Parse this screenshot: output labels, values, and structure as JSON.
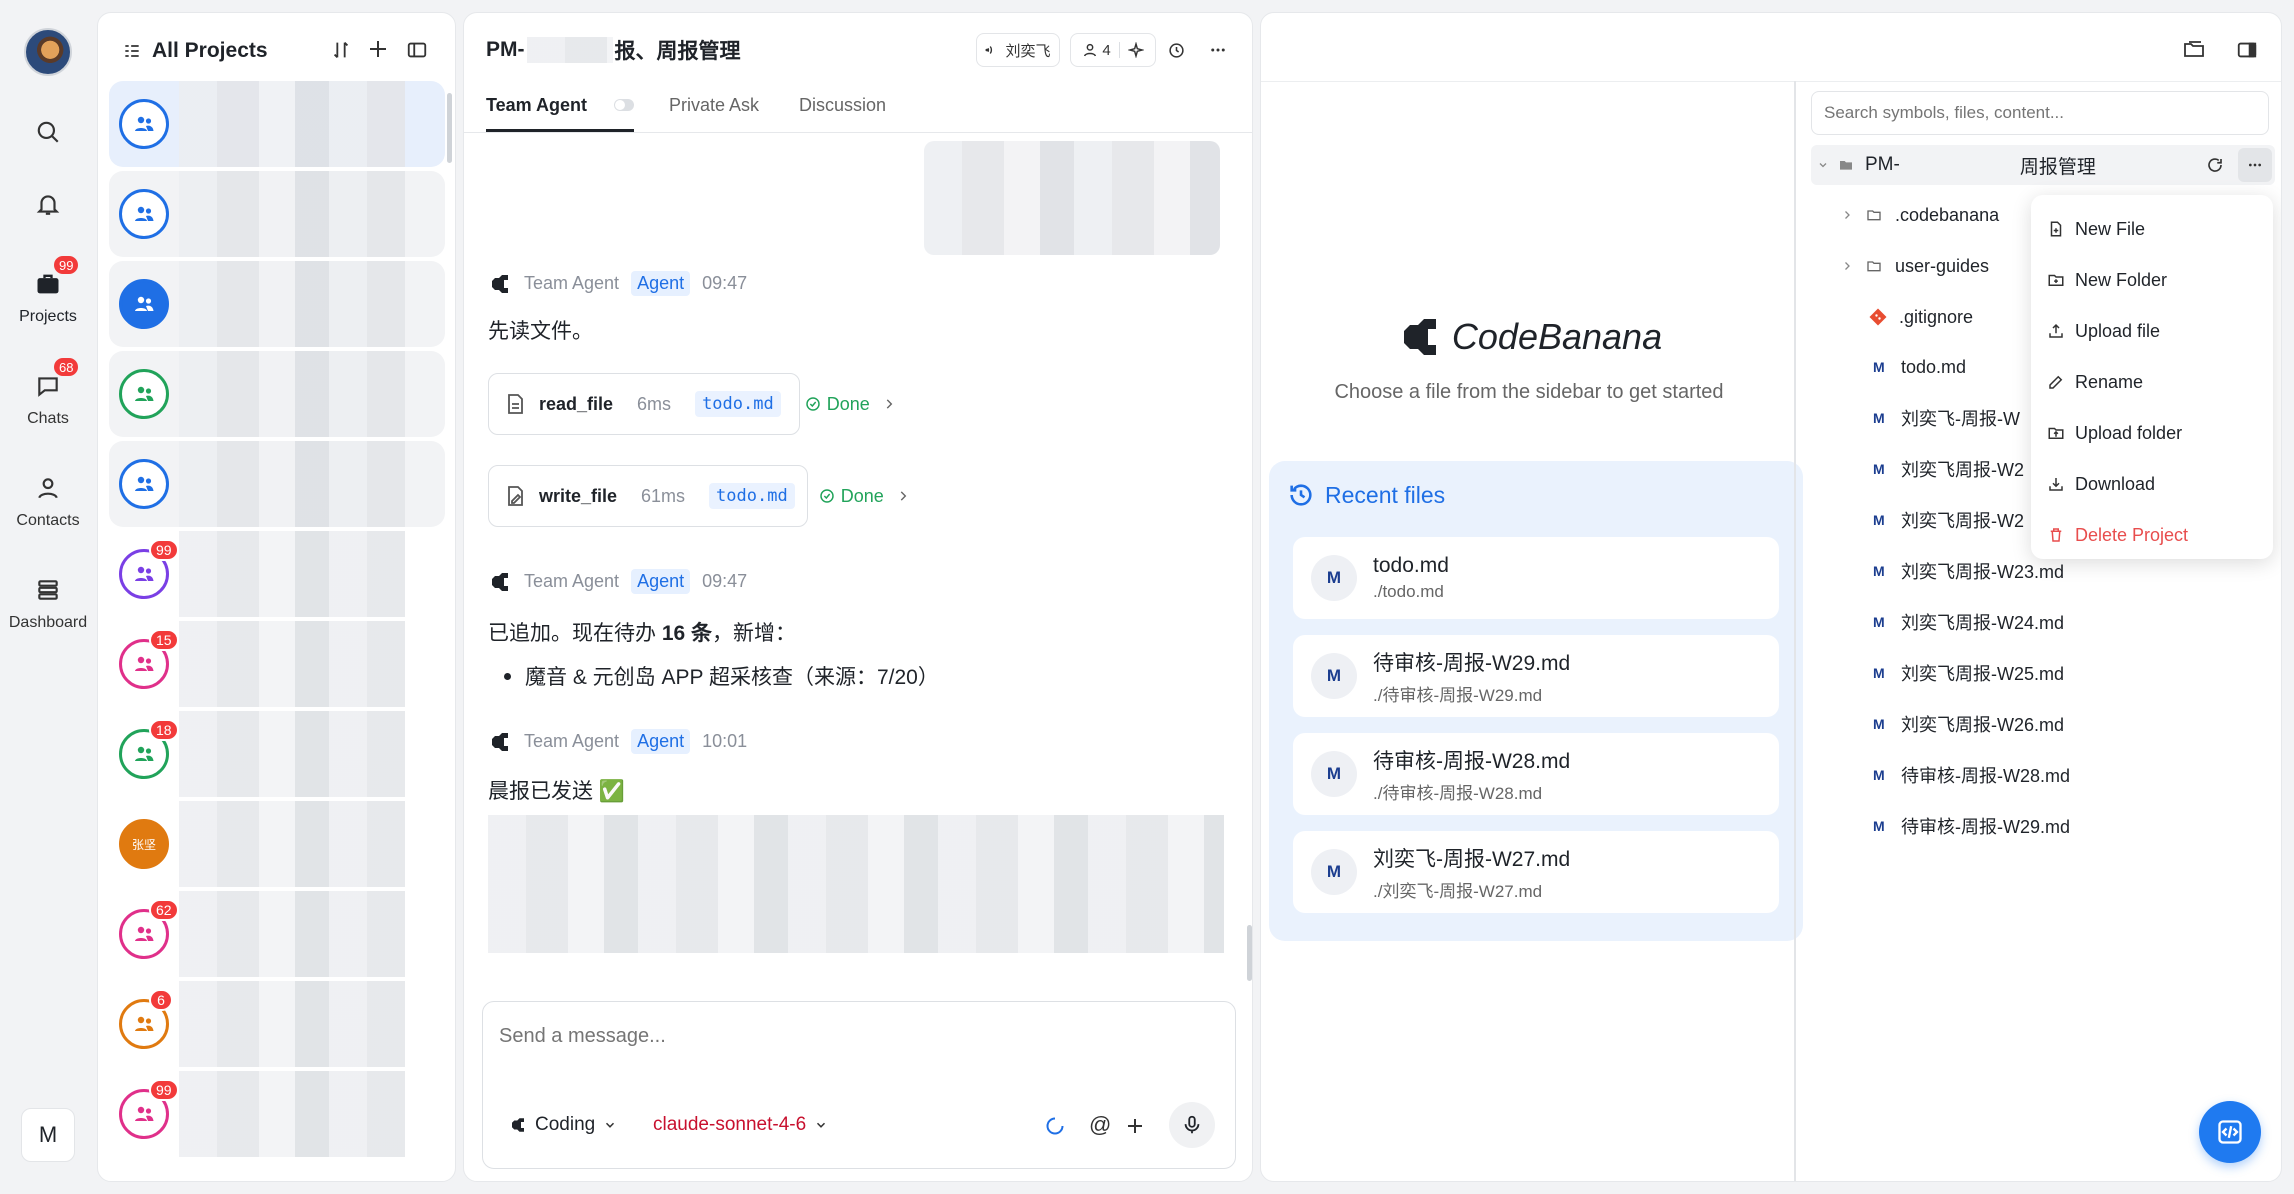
{
  "rail": {
    "avatar_initial": "",
    "items": [
      {
        "label": "",
        "icon": "search-icon"
      },
      {
        "label": "",
        "icon": "bell-icon"
      },
      {
        "label": "Projects",
        "badge": "99",
        "icon": "briefcase-icon"
      },
      {
        "label": "Chats",
        "badge": "68",
        "icon": "chat-icon"
      },
      {
        "label": "Contacts",
        "icon": "user-icon"
      },
      {
        "label": "Dashboard",
        "icon": "stack-icon"
      }
    ],
    "user_initial": "M"
  },
  "projects": {
    "title": "All Projects",
    "rows": [
      {
        "badge": "",
        "color": "#1f6fe5",
        "fill": false,
        "selected": true
      },
      {
        "badge": "",
        "color": "#1f6fe5",
        "fill": false
      },
      {
        "badge": "",
        "color": "#1f6fe5",
        "fill": true
      },
      {
        "badge": "",
        "color": "#21a35a",
        "fill": false
      },
      {
        "badge": "",
        "color": "#1f6fe5",
        "fill": false
      },
      {
        "badge": "99",
        "color": "#7a3fe5",
        "fill": false
      },
      {
        "badge": "15",
        "color": "#e0308a",
        "fill": false
      },
      {
        "badge": "18",
        "color": "#21a35a",
        "fill": false
      },
      {
        "badge": "",
        "color": "#e07a10",
        "fill": true,
        "text": "张坚"
      },
      {
        "badge": "62",
        "color": "#e0308a",
        "fill": false
      },
      {
        "badge": "6",
        "color": "#e07a10",
        "fill": false
      },
      {
        "badge": "99",
        "color": "#e0308a",
        "fill": false
      }
    ]
  },
  "chat": {
    "title_prefix": "PM-",
    "title_suffix": "报、周报管理",
    "header_user": "刘奕飞",
    "member_count": "4",
    "tabs": [
      "Team Agent",
      "Private Ask",
      "Discussion"
    ],
    "messages": [
      {
        "sender": "Team Agent",
        "tag": "Agent",
        "time": "09:47",
        "text": "先读文件。"
      },
      {
        "sender": "Team Agent",
        "tag": "Agent",
        "time": "09:47",
        "text_pre": "已追加。现在待办 ",
        "text_bold": "16 条",
        "text_post": "，新增：",
        "bullet": "魔音 & 元创岛 APP 超采核查（来源：7/20）"
      },
      {
        "sender": "Team Agent",
        "tag": "Agent",
        "time": "10:01",
        "text": "晨报已发送 ✅"
      }
    ],
    "tools": [
      {
        "name": "read_file",
        "duration": "6ms",
        "file": "todo.md",
        "status": "Done"
      },
      {
        "name": "write_file",
        "duration": "61ms",
        "file": "todo.md",
        "status": "Done"
      }
    ],
    "input_placeholder": "Send a message...",
    "mode": "Coding",
    "model": "claude-sonnet-4-6"
  },
  "viewer": {
    "brand": "CodeBanana",
    "hint": "Choose a file from the sidebar to get started",
    "recent_title": "Recent files",
    "recent": [
      {
        "name": "todo.md",
        "path": "./todo.md"
      },
      {
        "name": "待审核-周报-W29.md",
        "path": "./待审核-周报-W29.md"
      },
      {
        "name": "待审核-周报-W28.md",
        "path": "./待审核-周报-W28.md"
      },
      {
        "name": "刘奕飞-周报-W27.md",
        "path": "./刘奕飞-周报-W27.md"
      }
    ]
  },
  "explorer": {
    "search_placeholder": "Search symbols, files, content...",
    "root_prefix": "PM-",
    "root_suffix": "周报管理",
    "folders": [
      ".codebanana",
      "user-guides"
    ],
    "gitignore": ".gitignore",
    "files": [
      "todo.md",
      "刘奕飞-周报-W",
      "刘奕飞周报-W2",
      "刘奕飞周报-W2",
      "刘奕飞周报-W23.md",
      "刘奕飞周报-W24.md",
      "刘奕飞周报-W25.md",
      "刘奕飞周报-W26.md",
      "待审核-周报-W28.md",
      "待审核-周报-W29.md"
    ],
    "md_letter": "M",
    "menu": [
      "New File",
      "New Folder",
      "Upload file",
      "Rename",
      "Upload folder",
      "Download",
      "Delete Project"
    ]
  }
}
